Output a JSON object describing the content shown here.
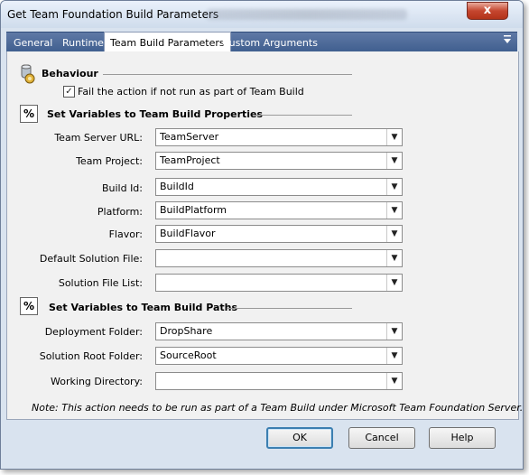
{
  "window": {
    "title": "Get Team Foundation Build Parameters",
    "close_label": "x"
  },
  "tabs": [
    {
      "label": "General"
    },
    {
      "label": "Runtime"
    },
    {
      "label": "Team Build Parameters"
    },
    {
      "label": "Custom Arguments"
    }
  ],
  "behaviour": {
    "title": "Behaviour",
    "checkbox_label": "Fail the action if not run as part of Team Build",
    "checked": true
  },
  "properties": {
    "title": "Set Variables to Team Build Properties",
    "fields": [
      {
        "label": "Team Server URL:",
        "value": "TeamServer"
      },
      {
        "label": "Team Project:",
        "value": "TeamProject"
      },
      {
        "label": "Build Id:",
        "value": "BuildId"
      },
      {
        "label": "Platform:",
        "value": "BuildPlatform"
      },
      {
        "label": "Flavor:",
        "value": "BuildFlavor"
      },
      {
        "label": "Default Solution File:",
        "value": ""
      },
      {
        "label": "Solution File List:",
        "value": ""
      }
    ]
  },
  "paths": {
    "title": "Set Variables to Team Build Paths",
    "fields": [
      {
        "label": "Deployment Folder:",
        "value": "DropShare"
      },
      {
        "label": "Solution Root Folder:",
        "value": "SourceRoot"
      },
      {
        "label": "Working Directory:",
        "value": ""
      }
    ]
  },
  "section_icon_text": "%",
  "note": "Note: This action needs to be run as part of a Team Build under Microsoft Team Foundation Server.",
  "buttons": {
    "ok": "OK",
    "cancel": "Cancel",
    "help": "Help"
  },
  "icons": {
    "behaviour": "gear-cylinder-icon",
    "variables": "percent-icon",
    "dropdown": "chevron-down-icon",
    "menu": "tab-menu-icon"
  }
}
